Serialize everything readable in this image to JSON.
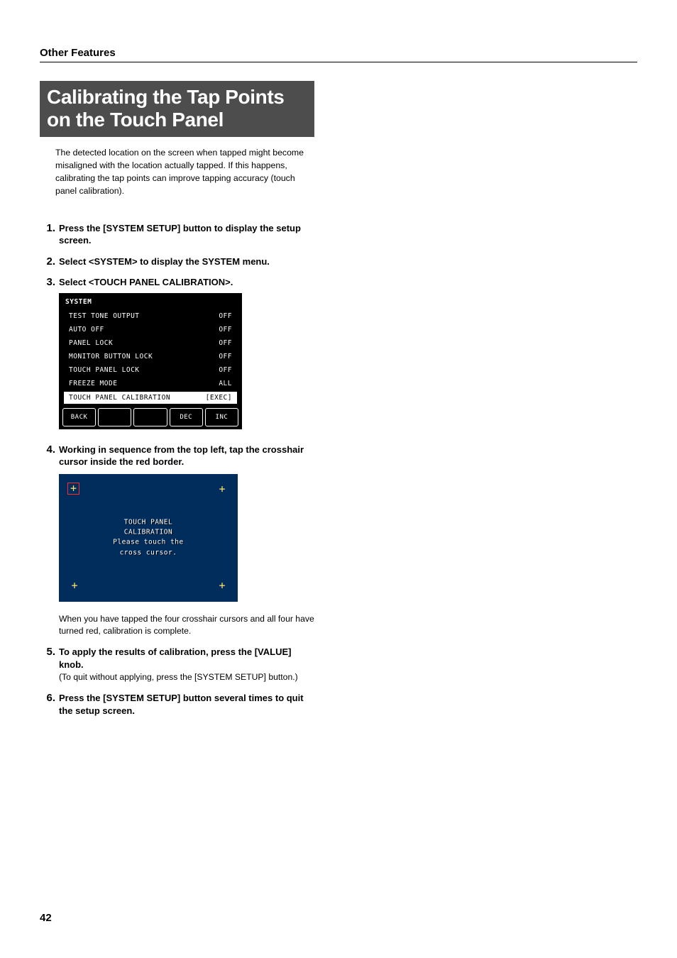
{
  "breadcrumb": "Other Features",
  "page_title": "Calibrating the Tap Points on the Touch Panel",
  "intro": "The detected location on the screen when tapped might become misaligned with the location actually tapped. If this happens, calibrating the tap points can improve tapping accuracy (touch panel calibration).",
  "steps": {
    "s1": {
      "num": "1.",
      "text": "Press the [SYSTEM SETUP] button to display the setup screen."
    },
    "s2": {
      "num": "2.",
      "text": "Select <SYSTEM> to display the SYSTEM menu."
    },
    "s3": {
      "num": "3.",
      "text": "Select <TOUCH PANEL CALIBRATION>."
    },
    "s4": {
      "num": "4.",
      "text": "Working in sequence from the top left, tap the crosshair cursor inside the red border."
    },
    "s5": {
      "num": "5.",
      "text": "To apply the results of calibration, press the [VALUE] knob.",
      "sub": "(To quit without applying, press the [SYSTEM SETUP] button.)"
    },
    "s6": {
      "num": "6.",
      "text": "Press the [SYSTEM SETUP] button several times to quit the setup screen."
    }
  },
  "sys_panel": {
    "title": "SYSTEM",
    "rows": [
      {
        "label": "TEST TONE OUTPUT",
        "value": "OFF"
      },
      {
        "label": "AUTO OFF",
        "value": "OFF"
      },
      {
        "label": "PANEL LOCK",
        "value": "OFF"
      },
      {
        "label": "MONITOR BUTTON LOCK",
        "value": "OFF"
      },
      {
        "label": "TOUCH PANEL LOCK",
        "value": "OFF"
      },
      {
        "label": "FREEZE MODE",
        "value": "ALL"
      },
      {
        "label": "TOUCH PANEL CALIBRATION",
        "value": "[EXEC]",
        "selected": true
      }
    ],
    "buttons": [
      "BACK",
      "",
      "",
      "DEC",
      "INC"
    ]
  },
  "calib": {
    "line1": "TOUCH PANEL CALIBRATION",
    "line2": "Please touch the cross cursor."
  },
  "note_after_calib": "When you have tapped the four crosshair cursors and all four have turned red, calibration is complete.",
  "page_num": "42"
}
